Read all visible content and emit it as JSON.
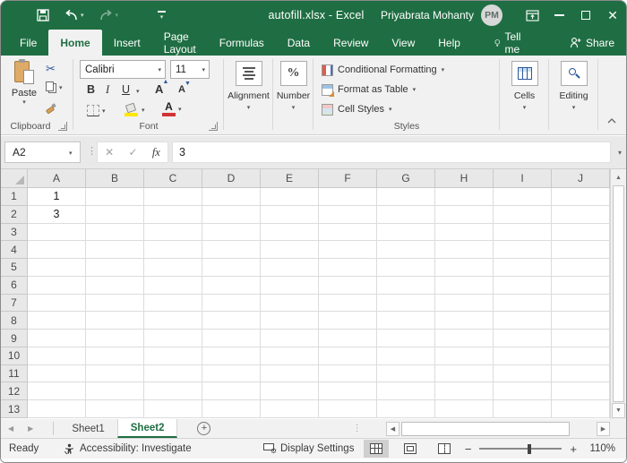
{
  "title_bar": {
    "title": "autofill.xlsx - Excel",
    "user_name": "Priyabrata Mohanty",
    "avatar_initials": "PM"
  },
  "ribbon_tabs": {
    "items": [
      "File",
      "Home",
      "Insert",
      "Page Layout",
      "Formulas",
      "Data",
      "Review",
      "View",
      "Help"
    ],
    "active": "Home",
    "tell_me": "Tell me",
    "share": "Share"
  },
  "ribbon": {
    "clipboard": {
      "paste": "Paste",
      "label": "Clipboard"
    },
    "font": {
      "family": "Calibri",
      "size": "11",
      "bold": "B",
      "italic": "I",
      "underline": "U",
      "grow": "A",
      "shrink": "A",
      "color_letter": "A",
      "label": "Font"
    },
    "alignment": {
      "label": "Alignment"
    },
    "number": {
      "percent": "%",
      "label": "Number"
    },
    "styles": {
      "conditional_formatting": "Conditional Formatting",
      "format_as_table": "Format as Table",
      "cell_styles": "Cell Styles",
      "label": "Styles"
    },
    "cells": {
      "label": "Cells"
    },
    "editing": {
      "label": "Editing"
    }
  },
  "formula_bar": {
    "name_box": "A2",
    "fx": "fx",
    "value": "3"
  },
  "grid": {
    "columns": [
      "A",
      "B",
      "C",
      "D",
      "E",
      "F",
      "G",
      "H",
      "I",
      "J"
    ],
    "row_count": 13,
    "cells": {
      "A1": "1",
      "A2": "3"
    }
  },
  "sheets": {
    "items": [
      "Sheet1",
      "Sheet2"
    ],
    "active": "Sheet2",
    "add_label": "+"
  },
  "status_bar": {
    "ready": "Ready",
    "accessibility": "Accessibility: Investigate",
    "display_settings": "Display Settings",
    "zoom_level": "110%"
  },
  "colors": {
    "excel_green": "#1f6e43",
    "ribbon_bg": "#f1f1f1",
    "fill_color_swatch": "#ffe600",
    "font_color_swatch": "#d13438"
  }
}
